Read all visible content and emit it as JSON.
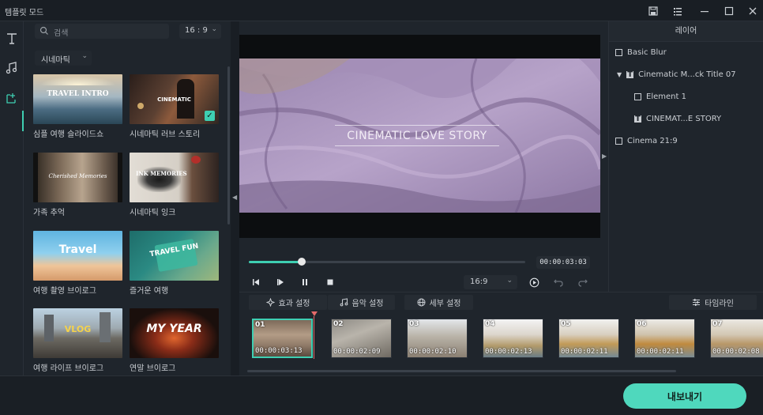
{
  "window": {
    "title": "템플릿 모드",
    "icons": [
      "save-icon",
      "list-icon",
      "minimize-icon",
      "maximize-icon",
      "close-icon"
    ]
  },
  "left_rail": {
    "items": [
      {
        "name": "text-tool",
        "glyph": "T"
      },
      {
        "name": "music-tool",
        "glyph": "♫"
      },
      {
        "name": "template-tool",
        "glyph": "⊞"
      }
    ]
  },
  "templates_panel": {
    "search_placeholder": "검색",
    "ratio": "16 : 9",
    "category": "시네마틱",
    "items": [
      {
        "label": "심플 여행 슬라이드쇼",
        "overlay": "TRAVEL INTRO",
        "selected": false
      },
      {
        "label": "시네마틱 러브 스토리",
        "overlay": "CINEMATIC",
        "selected": true
      },
      {
        "label": "가족 추억",
        "overlay": "Cherished Memories",
        "selected": false
      },
      {
        "label": "시네마틱 잉크",
        "overlay": "INK MEMORIES",
        "selected": false
      },
      {
        "label": "여행 촬영 브이로그",
        "overlay": "Travel",
        "selected": false
      },
      {
        "label": "즐거운 여행",
        "overlay": "TRAVEL FUN",
        "selected": false
      },
      {
        "label": "여행 라이프 브이로그",
        "overlay": "VLOG",
        "selected": false
      },
      {
        "label": "연말 브이로그",
        "overlay": "MY YEAR",
        "selected": false
      }
    ]
  },
  "preview": {
    "overlay_title": "CINEMATIC LOVE STORY",
    "timecode": "00:00:03:03",
    "progress": 0.19,
    "aspect": "16:9"
  },
  "layers_panel": {
    "header": "레이어",
    "items": [
      {
        "label": "Basic Blur",
        "indent": 0,
        "type": "box",
        "expanded": null
      },
      {
        "label": "Cinematic M...ck Title 07",
        "indent": 0,
        "type": "text",
        "expanded": true
      },
      {
        "label": "Element 1",
        "indent": 1,
        "type": "box",
        "expanded": null
      },
      {
        "label": "CINEMAT...E STORY",
        "indent": 1,
        "type": "text",
        "expanded": null
      },
      {
        "label": "Cinema 21:9",
        "indent": 0,
        "type": "box",
        "expanded": null
      }
    ]
  },
  "tabs": {
    "effects": "효과 설정",
    "music": "음악 설정",
    "details": "세부 설정",
    "timeline": "타임라인"
  },
  "timeline": {
    "clips": [
      {
        "num": "01",
        "dur": "00:00:03:13",
        "selected": true
      },
      {
        "num": "02",
        "dur": "00:00:02:09",
        "selected": false
      },
      {
        "num": "03",
        "dur": "00:00:02:10",
        "selected": false
      },
      {
        "num": "04",
        "dur": "00:00:02:13",
        "selected": false
      },
      {
        "num": "05",
        "dur": "00:00:02:11",
        "selected": false
      },
      {
        "num": "06",
        "dur": "00:00:02:11",
        "selected": false
      },
      {
        "num": "07",
        "dur": "00:00:02:08",
        "selected": false
      }
    ]
  },
  "footer": {
    "export_label": "내보내기"
  },
  "colors": {
    "accent": "#3ecfb2",
    "export": "#4fd8bd",
    "background": "#1f252c"
  }
}
